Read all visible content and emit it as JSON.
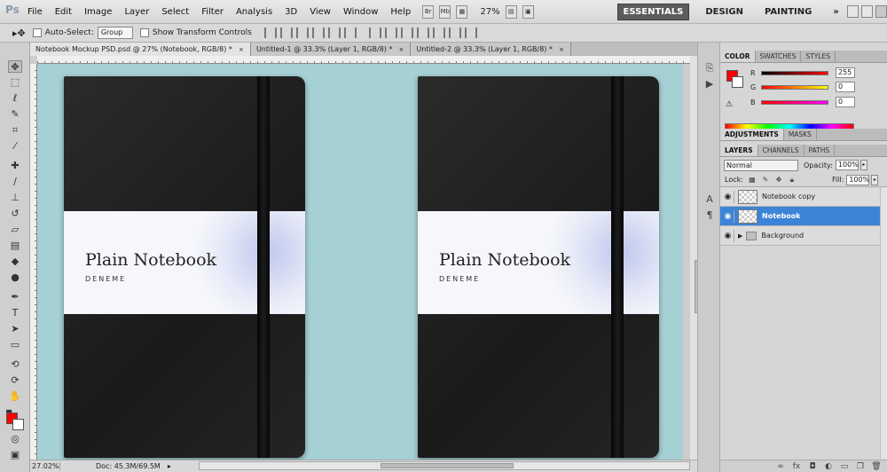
{
  "app": {
    "logo": "Ps",
    "menus": [
      "File",
      "Edit",
      "Image",
      "Layer",
      "Select",
      "Filter",
      "Analysis",
      "3D",
      "View",
      "Window",
      "Help"
    ],
    "menubar_icons": [
      "Br",
      "Mb"
    ],
    "zoom_display": "27%",
    "workspaces": [
      "ESSENTIALS",
      "DESIGN",
      "PAINTING"
    ],
    "more": "»"
  },
  "options_bar": {
    "auto_select_label": "Auto-Select:",
    "auto_select_value": "Group",
    "show_transform_label": "Show Transform Controls"
  },
  "documents": {
    "tabs": [
      {
        "label": "Notebook Mockup PSD.psd @ 27% (Notebook, RGB/8) *",
        "active": true
      },
      {
        "label": "Untitled-1 @ 33.3% (Layer 1, RGB/8) *",
        "active": false
      },
      {
        "label": "Untitled-2 @ 33.3% (Layer 1, RGB/8) *",
        "active": false
      }
    ],
    "close_glyph": "×"
  },
  "canvas": {
    "notebook_title": "Plain Notebook",
    "notebook_subtitle": "DENEME",
    "background_color": "#a5d0d4"
  },
  "status": {
    "zoom": "27.02%",
    "doc": "Doc: 45.3M/69.5M"
  },
  "color_panel": {
    "tabs": [
      "COLOR",
      "SWATCHES",
      "STYLES"
    ],
    "r_label": "R",
    "g_label": "G",
    "b_label": "B",
    "r_value": "255",
    "g_value": "0",
    "b_value": "0"
  },
  "adjustments_panel": {
    "tabs": [
      "ADJUSTMENTS",
      "MASKS"
    ]
  },
  "layers_panel": {
    "tabs": [
      "LAYERS",
      "CHANNELS",
      "PATHS"
    ],
    "blend_mode": "Normal",
    "opacity_label": "Opacity:",
    "opacity_value": "100%",
    "lock_label": "Lock:",
    "fill_label": "Fill:",
    "fill_value": "100%",
    "layers": [
      {
        "name": "Notebook copy",
        "selected": false
      },
      {
        "name": "Notebook",
        "selected": true
      },
      {
        "name": "Background",
        "selected": false
      }
    ]
  },
  "colors": {
    "foreground": "#ff0000",
    "background": "#ffffff",
    "selection": "#3c84d8"
  }
}
